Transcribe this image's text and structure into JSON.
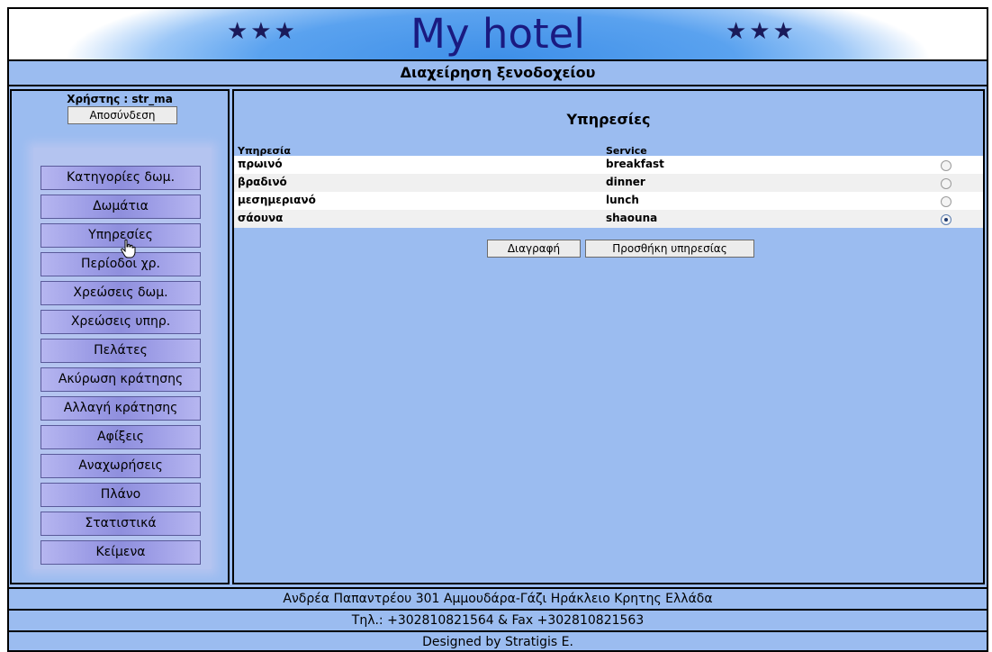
{
  "header": {
    "stars_left": "★★★",
    "title": "My hotel",
    "stars_right": "★★★",
    "subtitle": "Διαχείρηση ξενοδοχείου"
  },
  "sidebar": {
    "user_line": "Χρήστης : str_ma",
    "logout_label": "Αποσύνδεση",
    "menu": [
      {
        "label": "Κατηγορίες δωμ."
      },
      {
        "label": "Δωμάτια"
      },
      {
        "label": "Υπηρεσίες"
      },
      {
        "label": "Περίοδοι χρ."
      },
      {
        "label": "Χρεώσεις δωμ."
      },
      {
        "label": "Χρεώσεις υπηρ."
      },
      {
        "label": "Πελάτες"
      },
      {
        "label": "Ακύρωση κράτησης"
      },
      {
        "label": "Αλλαγή κράτησης"
      },
      {
        "label": "Αφίξεις"
      },
      {
        "label": "Αναχωρήσεις"
      },
      {
        "label": "Πλάνο"
      },
      {
        "label": "Στατιστικά"
      },
      {
        "label": "Κείμενα"
      }
    ]
  },
  "main": {
    "title": "Υπηρεσίες",
    "columns": [
      "Υπηρεσία",
      "Service"
    ],
    "rows": [
      {
        "greek": "πρωινό",
        "english": "breakfast",
        "selected": false
      },
      {
        "greek": "βραδινό",
        "english": "dinner",
        "selected": false
      },
      {
        "greek": "μεσημεριανό",
        "english": "lunch",
        "selected": false
      },
      {
        "greek": "σάουνα",
        "english": "shaouna",
        "selected": true
      }
    ],
    "delete_label": "Διαγραφή",
    "add_label": "Προσθήκη υπηρεσίας"
  },
  "footer": {
    "address": "Ανδρέα Παπαντρέου 301 Αμμουδάρα-Γάζι Ηράκλειο Κρητης Ελλάδα",
    "phone": "Τηλ.: +302810821564 & Fax +302810821563",
    "credit": "Designed by Stratigis E."
  },
  "colors": {
    "page_bg": "#9bbcf0",
    "menu_button": "#9d9de6",
    "title_text": "#1a1a80"
  }
}
